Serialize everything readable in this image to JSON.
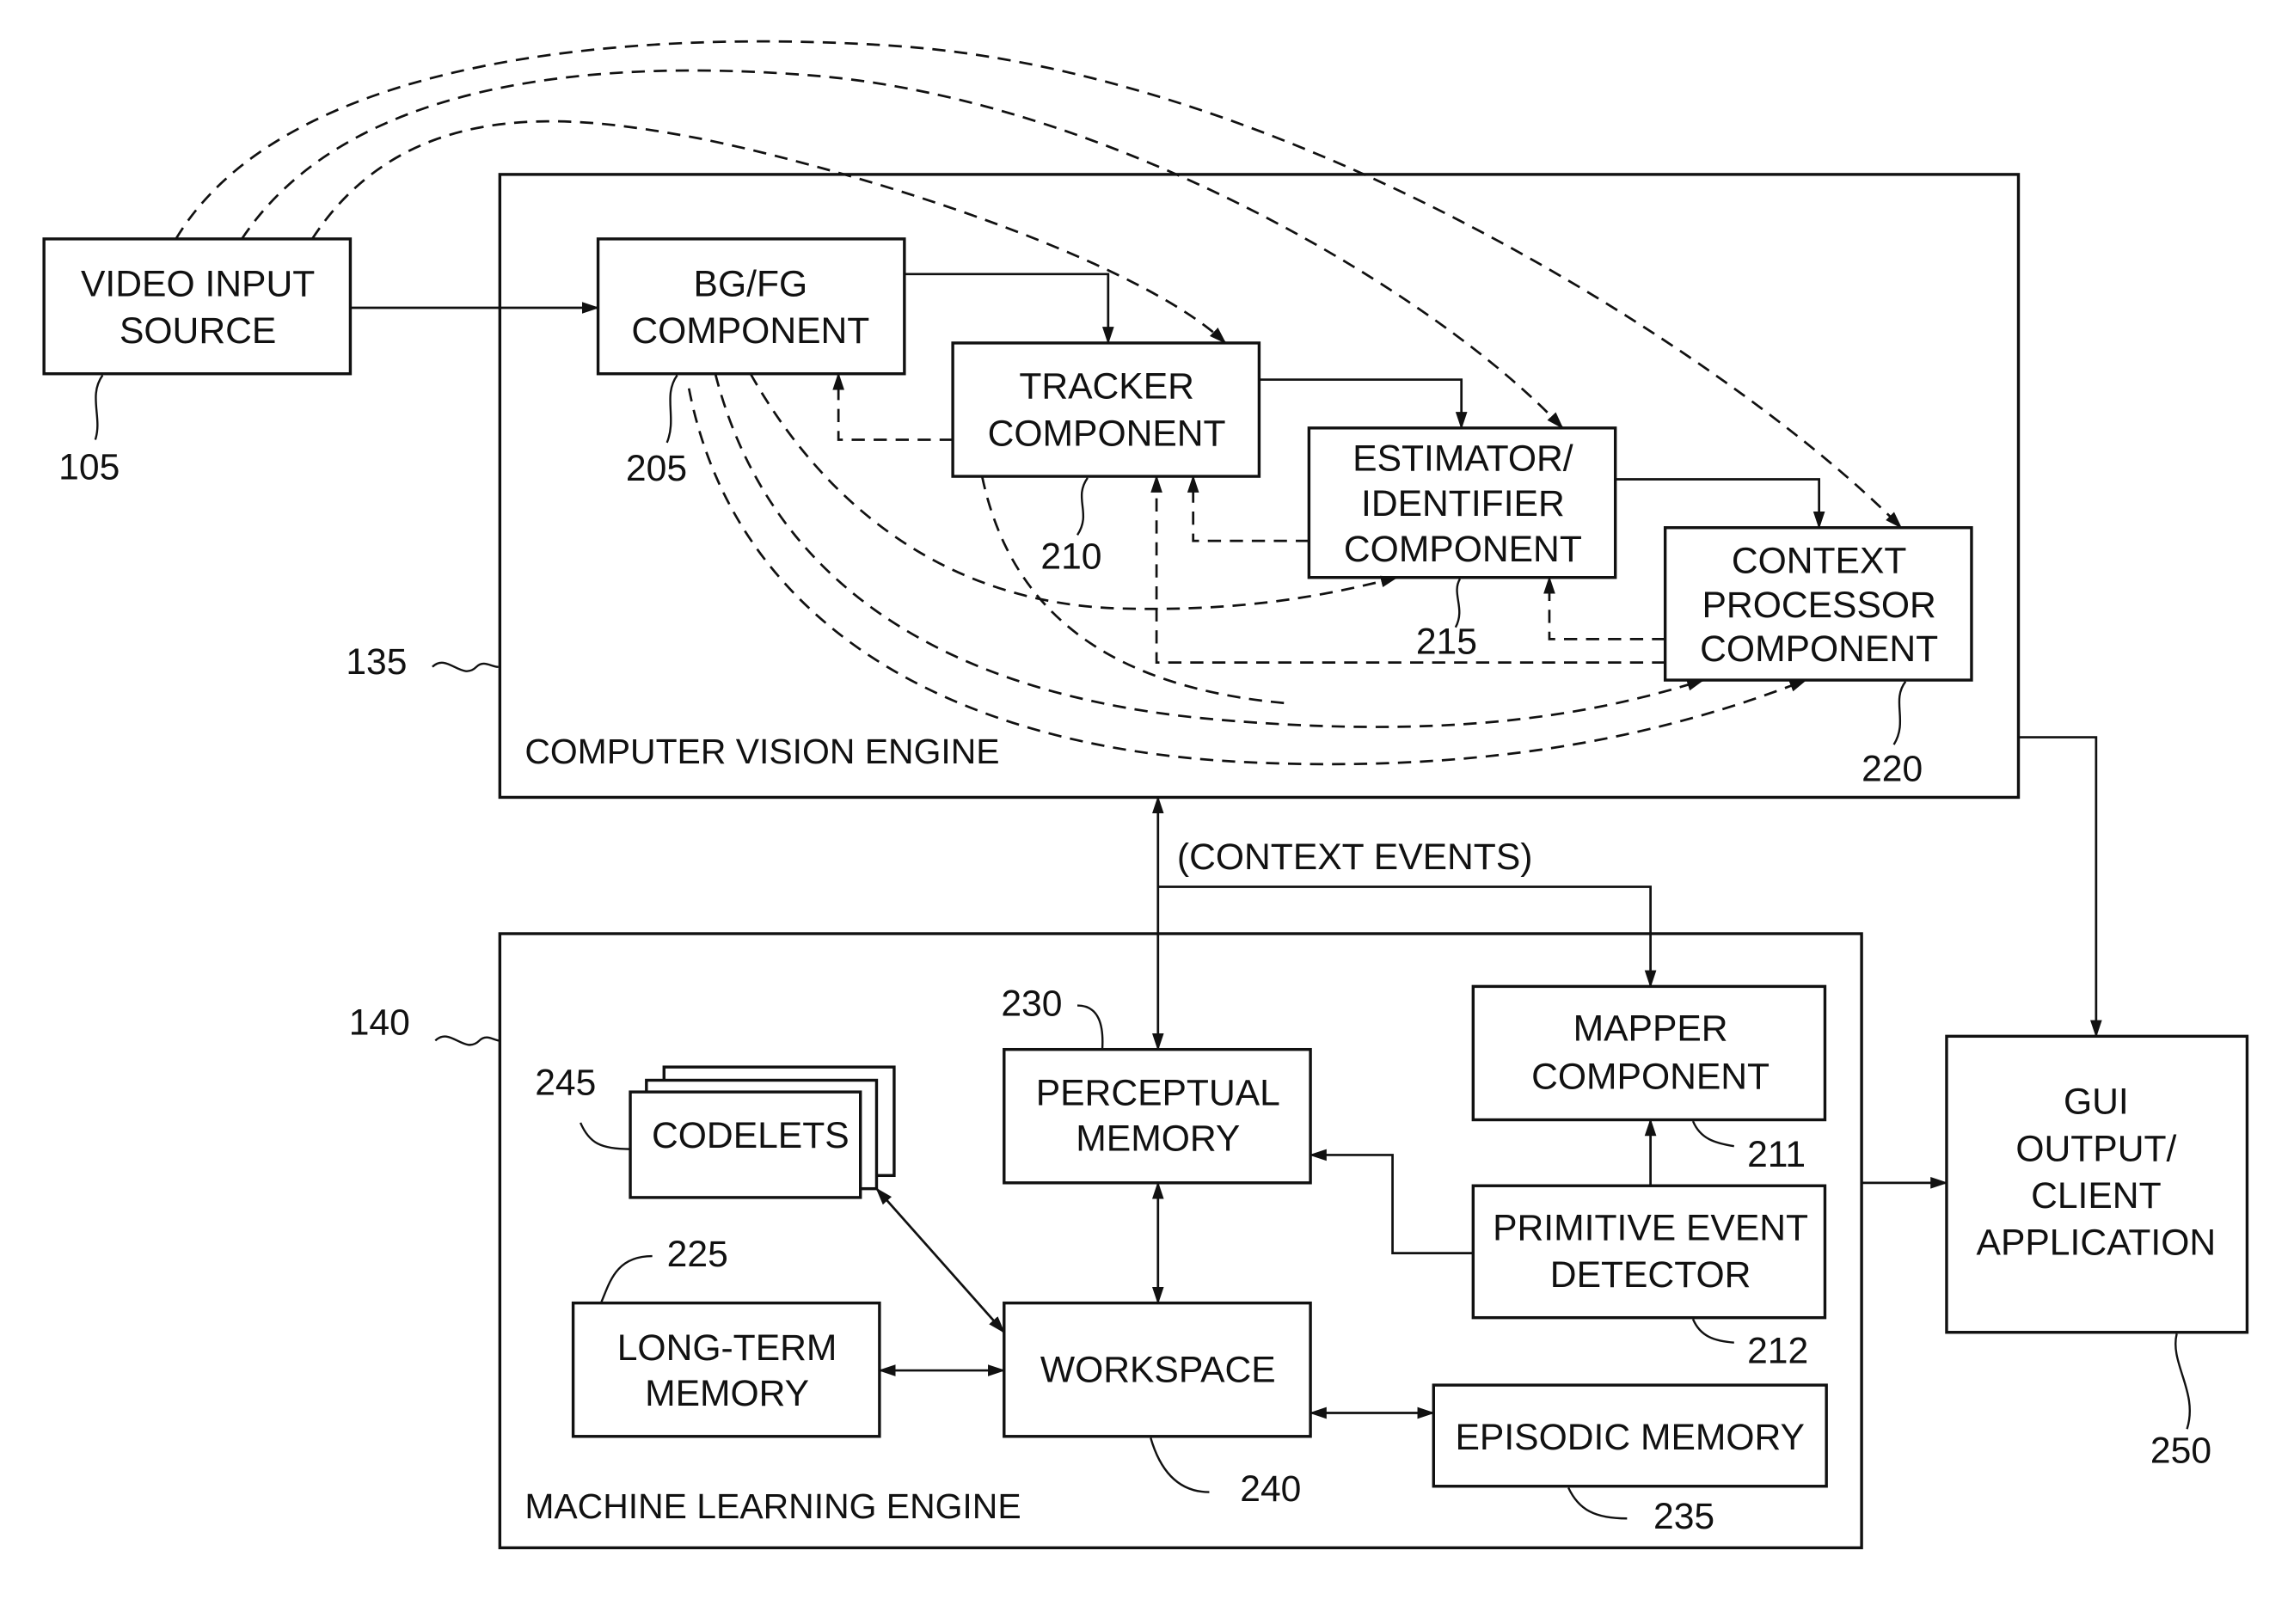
{
  "diagram": {
    "engines": {
      "cv": {
        "title": "COMPUTER VISION ENGINE",
        "ref": "135"
      },
      "ml": {
        "title": "MACHINE LEARNING ENGINE",
        "ref": "140"
      }
    },
    "blocks": {
      "video_input": {
        "lines": [
          "VIDEO INPUT",
          "SOURCE"
        ],
        "ref": "105"
      },
      "bgfg": {
        "lines": [
          "BG/FG",
          "COMPONENT"
        ],
        "ref": "205"
      },
      "tracker": {
        "lines": [
          "TRACKER",
          "COMPONENT"
        ],
        "ref": "210"
      },
      "estimator": {
        "lines": [
          "ESTIMATOR/",
          "IDENTIFIER",
          "COMPONENT"
        ],
        "ref": "215"
      },
      "context_processor": {
        "lines": [
          "CONTEXT",
          "PROCESSOR",
          "COMPONENT"
        ],
        "ref": "220"
      },
      "perceptual_memory": {
        "lines": [
          "PERCEPTUAL",
          "MEMORY"
        ],
        "ref": "230"
      },
      "mapper": {
        "lines": [
          "MAPPER",
          "COMPONENT"
        ],
        "ref": "211"
      },
      "primitive_event_detector": {
        "lines": [
          "PRIMITIVE EVENT",
          "DETECTOR"
        ],
        "ref": "212"
      },
      "codelets": {
        "lines": [
          "CODELETS"
        ],
        "ref": "245"
      },
      "long_term_memory": {
        "lines": [
          "LONG-TERM",
          "MEMORY"
        ],
        "ref": "225"
      },
      "workspace": {
        "lines": [
          "WORKSPACE"
        ],
        "ref": "240"
      },
      "episodic_memory": {
        "lines": [
          "EPISODIC MEMORY"
        ],
        "ref": "235"
      },
      "gui_output": {
        "lines": [
          "GUI",
          "OUTPUT/",
          "CLIENT",
          "APPLICATION"
        ],
        "ref": "250"
      }
    },
    "annotations": {
      "context_events": "(CONTEXT EVENTS)"
    }
  }
}
